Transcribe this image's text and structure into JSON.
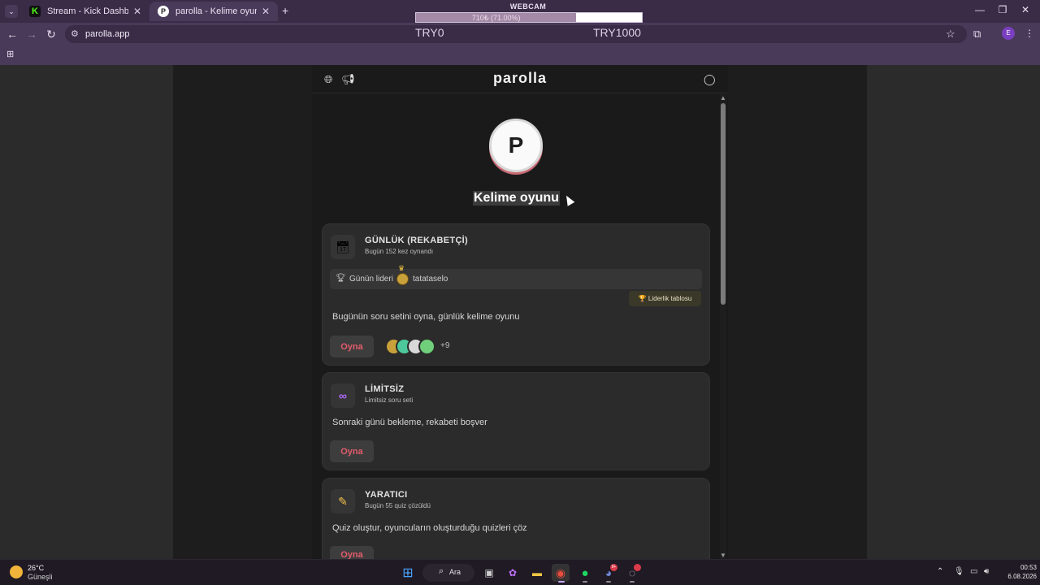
{
  "browser": {
    "tabs": [
      {
        "title": "Stream - Kick Dashboard",
        "favicon_color": "#53fc18"
      },
      {
        "title": "parolla - Kelime oyunu. Günlük",
        "favicon_color": "#ffffff",
        "active": true
      }
    ],
    "new_tab_label": "+",
    "url": "parolla.app"
  },
  "stream_overlay": {
    "webcam_label": "WEBCAM",
    "goal_text": "710₺ (71.00%)",
    "goal_progress": 0.71,
    "goal_min": "TRY0",
    "goal_max": "TRY1000"
  },
  "app": {
    "brand": "parolla",
    "logo_letter": "P",
    "tagline": "Kelime oyunu"
  },
  "cards": {
    "daily": {
      "icon": "calendar-icon",
      "title": "GÜNLÜK (REKABETÇİ)",
      "subtitle": "Bugün 152 kez oynandı",
      "leader_label": "Günün lideri",
      "leader_name": "tatataselo",
      "leaderboard_label": "🏆 Liderlik tablosu",
      "description": "Bugünün soru setini oyna, günlük kelime oyunu",
      "play_label": "Oyna",
      "extra_players": "+9"
    },
    "unlimited": {
      "icon": "infinity-icon",
      "title": "LİMİTSİZ",
      "subtitle": "Limitsiz soru seti",
      "description": "Sonraki günü bekleme, rekabeti boşver",
      "play_label": "Oyna"
    },
    "creator": {
      "icon": "pencil-icon",
      "title": "YARATICI",
      "subtitle": "Bugün 55 quiz çözüldü",
      "description": "Quiz oluştur, oyuncuların oluşturduğu quizleri çöz",
      "play_label": "Oyna"
    }
  },
  "taskbar": {
    "weather_temp": "26°C",
    "weather_desc": "Güneşli",
    "search_label": "Ara",
    "time": "00:53",
    "date": "6.08.2026",
    "discord_badge": "9+"
  },
  "colors": {
    "accent_red": "#e45c6c",
    "browser_chrome": "#4a3a5a",
    "page_background": "#1a1a1a"
  }
}
